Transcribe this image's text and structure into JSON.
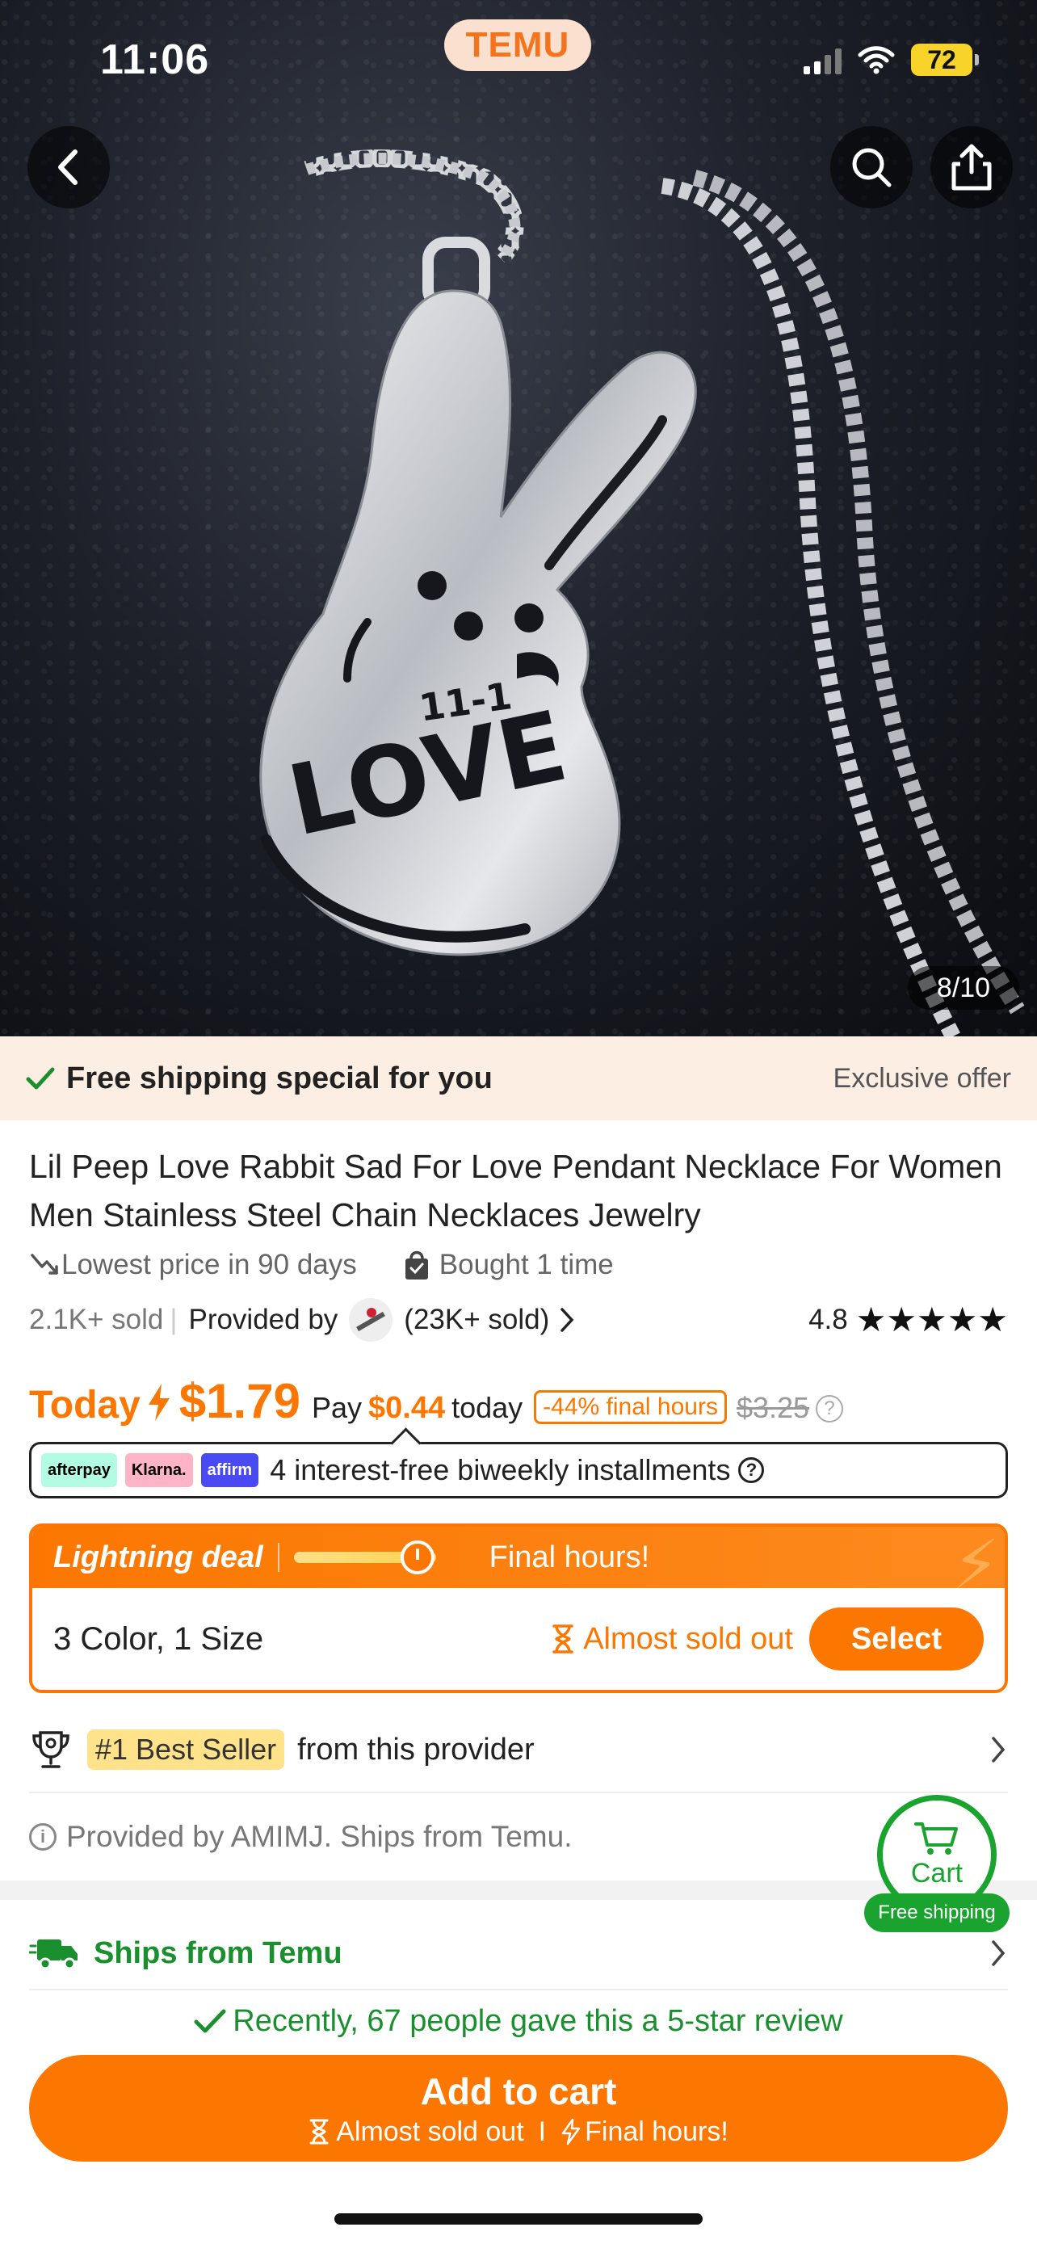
{
  "status_bar": {
    "time": "11:06",
    "battery": "72"
  },
  "header": {
    "logo_text": "TEMU"
  },
  "hero": {
    "image_counter": "8/10",
    "pendant_text": "11-1 LOVE"
  },
  "shipping_banner": {
    "text": "Free shipping special for you",
    "right_text": "Exclusive offer"
  },
  "product": {
    "title": "Lil Peep Love Rabbit Sad For Love Pendant Necklace For Women Men Stainless Steel Chain Necklaces Jewelry",
    "lowest_price": "Lowest price in 90 days",
    "bought": "Bought 1 time",
    "sold": "2.1K+ sold",
    "provided_by": "Provided by",
    "seller_sold": "(23K+ sold)",
    "rating": "4.8",
    "stars": 5
  },
  "price": {
    "today_label": "Today",
    "price": "$1.79",
    "pay_label": "Pay",
    "pay_amount": "$0.44",
    "pay_suffix": "today",
    "discount": "-44% final hours",
    "original": "$3.25"
  },
  "installments": {
    "logos": [
      "afterpay",
      "Klarna.",
      "affirm"
    ],
    "text": "4 interest-free biweekly installments"
  },
  "deal": {
    "label": "Lightning deal",
    "final_hours": "Final hours!",
    "variant": "3 Color, 1 Size",
    "stock": "Almost sold out",
    "select_label": "Select"
  },
  "best_seller": {
    "badge": "#1 Best Seller",
    "text": "from this provider"
  },
  "provided_line": "Provided by AMIMJ. Ships from Temu.",
  "ships_from": "Ships from Temu",
  "review_note": "Recently, 67 people gave this a 5-star review",
  "add_to_cart": {
    "label": "Add to cart",
    "sub_stock": "Almost sold out",
    "sub_separator": "I",
    "sub_final": "Final hours!"
  },
  "cart_float": {
    "label": "Cart",
    "pill": "Free shipping"
  },
  "colors": {
    "accent": "#fb7701",
    "green": "#1aa32e",
    "banner_bg": "#fdeee3"
  }
}
